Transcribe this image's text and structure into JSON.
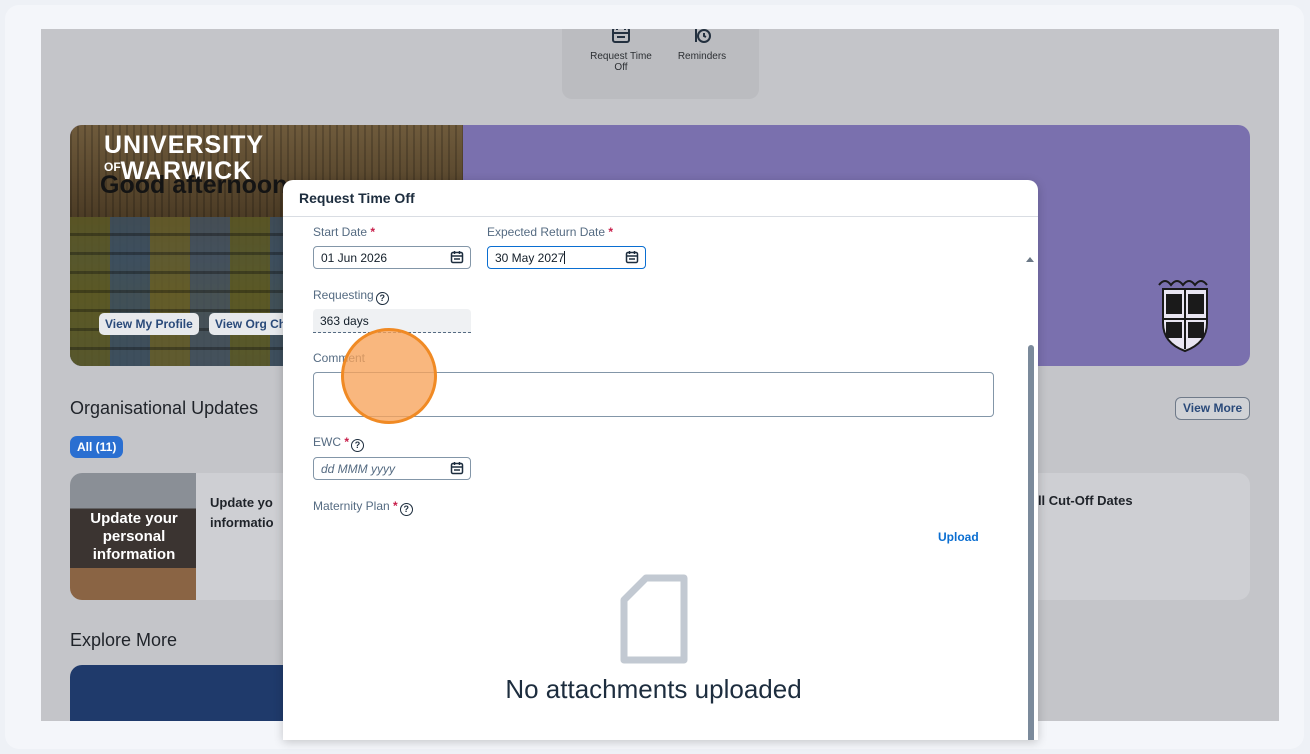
{
  "shortcuts": [
    {
      "label": "Request Time Off",
      "icon": "calendar-icon"
    },
    {
      "label": "Reminders",
      "icon": "reminder-clock-icon"
    }
  ],
  "banner": {
    "logo_line1": "UNIVERSITY",
    "logo_of": "OF",
    "logo_line2": "WARWICK",
    "greeting": "Good afternoon",
    "view_profile": "View My Profile",
    "view_org_chart": "View Org Ch",
    "banner_color": "#7a70ae"
  },
  "updates": {
    "title": "Organisational Updates",
    "view_more": "View More",
    "filter_chip": "All (11)",
    "card_image_text": "Update your personal information",
    "card_title_line1": "Update yo",
    "card_title_line2": "informatio",
    "card_right_title": "oll Cut-Off Dates"
  },
  "explore": {
    "title": "Explore More"
  },
  "modal": {
    "title": "Request Time Off",
    "start_date_label": "Start Date",
    "start_date_value": "01 Jun 2026",
    "return_date_label": "Expected Return Date",
    "return_date_value": "30 May 2027",
    "requesting_label": "Requesting",
    "requesting_value": "363 days",
    "comment_label": "Comment",
    "ewc_label": "EWC",
    "ewc_placeholder": "dd MMM yyyy",
    "maternity_label": "Maternity Plan",
    "upload_label": "Upload",
    "no_attachments": "No attachments uploaded",
    "required_mark": "*",
    "help_glyph": "?"
  },
  "colors": {
    "accent": "#0a6ed1",
    "required": "#c81e4a",
    "chip": "#2a6fd1"
  }
}
